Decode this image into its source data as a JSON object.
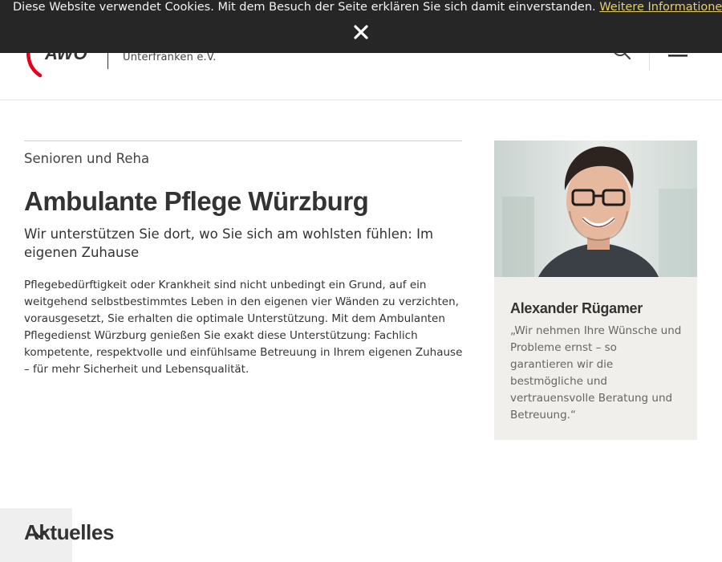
{
  "cookie_bar": {
    "message": "Diese Website verwendet Cookies. Mit dem Besuch der Seite erklären Sie sich damit einverstanden.",
    "link_label": "Weitere Informationen",
    "close_glyph": "×"
  },
  "header": {
    "org_line2": "Unterfranken e.V."
  },
  "main": {
    "category": "Senioren und Reha",
    "title": "Ambulante Pflege Würzburg",
    "subtitle": "Wir unterstützen Sie dort, wo Sie sich am wohlsten fühlen: Im eigenen Zuhause",
    "body": "Pflegebedürftigkeit oder Krankheit sind nicht unbedingt ein Grund, auf ein weitgehend selbstbestimmtes Leben in den eigenen vier Wänden zu verzichten, vorausgesetzt, Sie erhalten die optimale Unterstützung. Mit dem Ambulanten Pflegedienst Würzburg genießen Sie exakt diese Unterstützung: Fachlich kompetente, respektvolle und einfühlsame Betreuung in Ihrem eigenen Zuhause – für mehr Sicherheit und Lebensqualität."
  },
  "contact": {
    "name": "Alexander Rügamer",
    "quote": "„Wir nehmen Ihre Wünsche und Probleme ernst  – so garantieren wir die bestmögliche und vertrauensvolle Beratung und Betreuung.“"
  },
  "news": {
    "heading": "Aktuelles"
  },
  "colors": {
    "brand_red": "#e2001a",
    "cookie_bg": "#262626",
    "cookie_link": "#e3cf6a",
    "card_bg": "#f0efeb"
  },
  "icons": {
    "logo": "awo-logo",
    "search": "search-icon",
    "menu": "hamburger-menu-icon",
    "close": "close-icon",
    "collapse": "chevron-down-icon"
  }
}
